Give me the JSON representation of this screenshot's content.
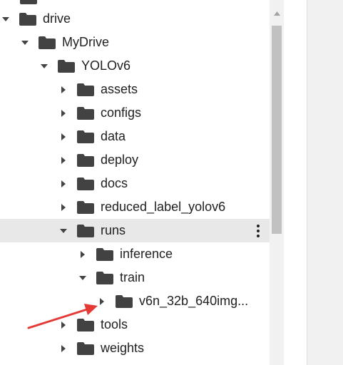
{
  "tree": [
    {
      "label": "drive",
      "level": 0,
      "expanded": true,
      "selected": false
    },
    {
      "label": "MyDrive",
      "level": 1,
      "expanded": true,
      "selected": false
    },
    {
      "label": "YOLOv6",
      "level": 2,
      "expanded": true,
      "selected": false
    },
    {
      "label": "assets",
      "level": 3,
      "expanded": false,
      "selected": false
    },
    {
      "label": "configs",
      "level": 3,
      "expanded": false,
      "selected": false
    },
    {
      "label": "data",
      "level": 3,
      "expanded": false,
      "selected": false
    },
    {
      "label": "deploy",
      "level": 3,
      "expanded": false,
      "selected": false
    },
    {
      "label": "docs",
      "level": 3,
      "expanded": false,
      "selected": false
    },
    {
      "label": "reduced_label_yolov6",
      "level": 3,
      "expanded": false,
      "selected": false
    },
    {
      "label": "runs",
      "level": 3,
      "expanded": true,
      "selected": true
    },
    {
      "label": "inference",
      "level": 4,
      "expanded": false,
      "selected": false
    },
    {
      "label": "train",
      "level": 4,
      "expanded": true,
      "selected": false
    },
    {
      "label": "v6n_32b_640img...",
      "level": 5,
      "expanded": false,
      "selected": false
    },
    {
      "label": "tools",
      "level": 3,
      "expanded": false,
      "selected": false
    },
    {
      "label": "weights",
      "level": 3,
      "expanded": false,
      "selected": false
    }
  ],
  "icons": {
    "folder": "folder-icon",
    "caret_expanded": "caret-down-icon",
    "caret_collapsed": "caret-right-icon",
    "more": "more-vert-icon",
    "annotation": "red-arrow-annotation"
  },
  "colors": {
    "folder": "#424242",
    "selected_row": "#e8e8e8",
    "annotation_arrow": "#e53935",
    "scrollbar_thumb": "#c1c1c1"
  }
}
